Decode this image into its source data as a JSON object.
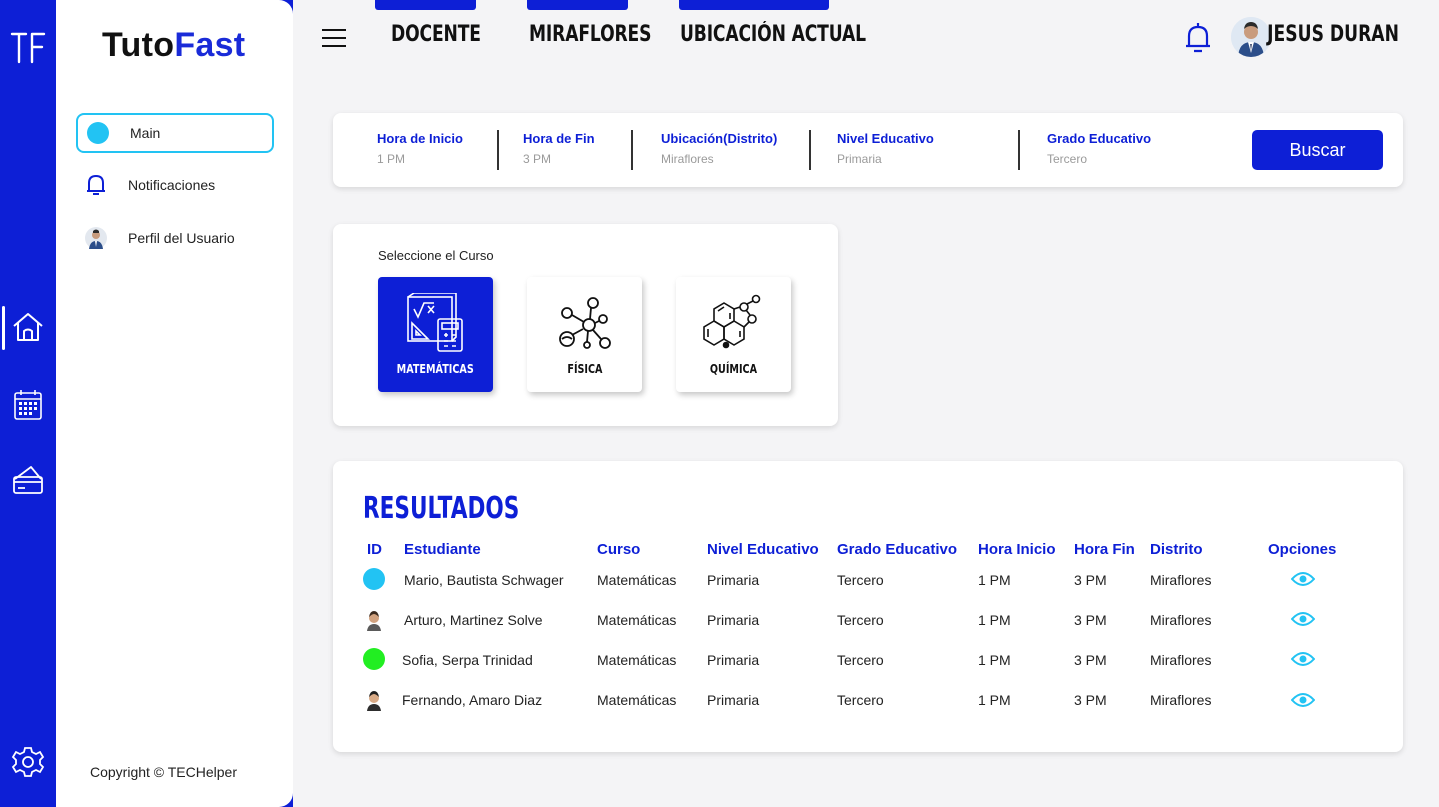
{
  "app": {
    "brand_part1": "Tuto",
    "brand_part2": "Fast",
    "accent_color": "#0d1fd6",
    "highlight_color": "#22c3f3"
  },
  "rail": {
    "icons": [
      "tf-logo-icon",
      "home-icon",
      "calendar-icon",
      "payment-card-icon",
      "settings-icon"
    ]
  },
  "sidebar": {
    "items": [
      {
        "label": "Main",
        "icon": "dot-icon",
        "active": true
      },
      {
        "label": "Notificaciones",
        "icon": "bell-icon",
        "active": false
      },
      {
        "label": "Perfil del Usuario",
        "icon": "avatar",
        "active": false
      }
    ],
    "copyright": "Copyright © TECHelper"
  },
  "topbar": {
    "tabs": [
      "DOCENTE",
      "MIRAFLORES",
      "UBICACIÓN ACTUAL"
    ],
    "user_name": "JESUS DURAN"
  },
  "filters": [
    {
      "label": "Hora de Inicio",
      "value": "1 PM"
    },
    {
      "label": "Hora de Fin",
      "value": "3 PM"
    },
    {
      "label": "Ubicación(Distrito)",
      "value": "Miraflores"
    },
    {
      "label": "Nivel Educativo",
      "value": "Primaria"
    },
    {
      "label": "Grado Educativo",
      "value": "Tercero"
    }
  ],
  "search_button": "Buscar",
  "courses": {
    "title": "Seleccione el Curso",
    "items": [
      {
        "name": "MATEMÁTICAS",
        "selected": true
      },
      {
        "name": "FÍSICA",
        "selected": false
      },
      {
        "name": "QUÍMICA",
        "selected": false
      }
    ]
  },
  "results": {
    "title": "RESULTADOS",
    "columns": [
      "ID",
      "Estudiante",
      "Curso",
      "Nivel Educativo",
      "Grado Educativo",
      "Hora Inicio",
      "Hora Fin",
      "Distrito",
      "Opciones"
    ],
    "rows": [
      {
        "avatar": "#22c3f3",
        "student": "Mario, Bautista Schwager",
        "course": "Matemáticas",
        "level": "Primaria",
        "grade": "Tercero",
        "start": "1 PM",
        "end": "3 PM",
        "district": "Miraflores"
      },
      {
        "avatar": "photo",
        "student": "Arturo, Martinez Solve",
        "course": "Matemáticas",
        "level": "Primaria",
        "grade": "Tercero",
        "start": "1 PM",
        "end": "3 PM",
        "district": "Miraflores"
      },
      {
        "avatar": "#22ee22",
        "student": "Sofia, Serpa Trinidad",
        "course": "Matemáticas",
        "level": "Primaria",
        "grade": "Tercero",
        "start": "1 PM",
        "end": "3 PM",
        "district": "Miraflores"
      },
      {
        "avatar": "photo",
        "student": "Fernando, Amaro Diaz",
        "course": "Matemáticas",
        "level": "Primaria",
        "grade": "Tercero",
        "start": "1 PM",
        "end": "3 PM",
        "district": "Miraflores"
      }
    ]
  }
}
